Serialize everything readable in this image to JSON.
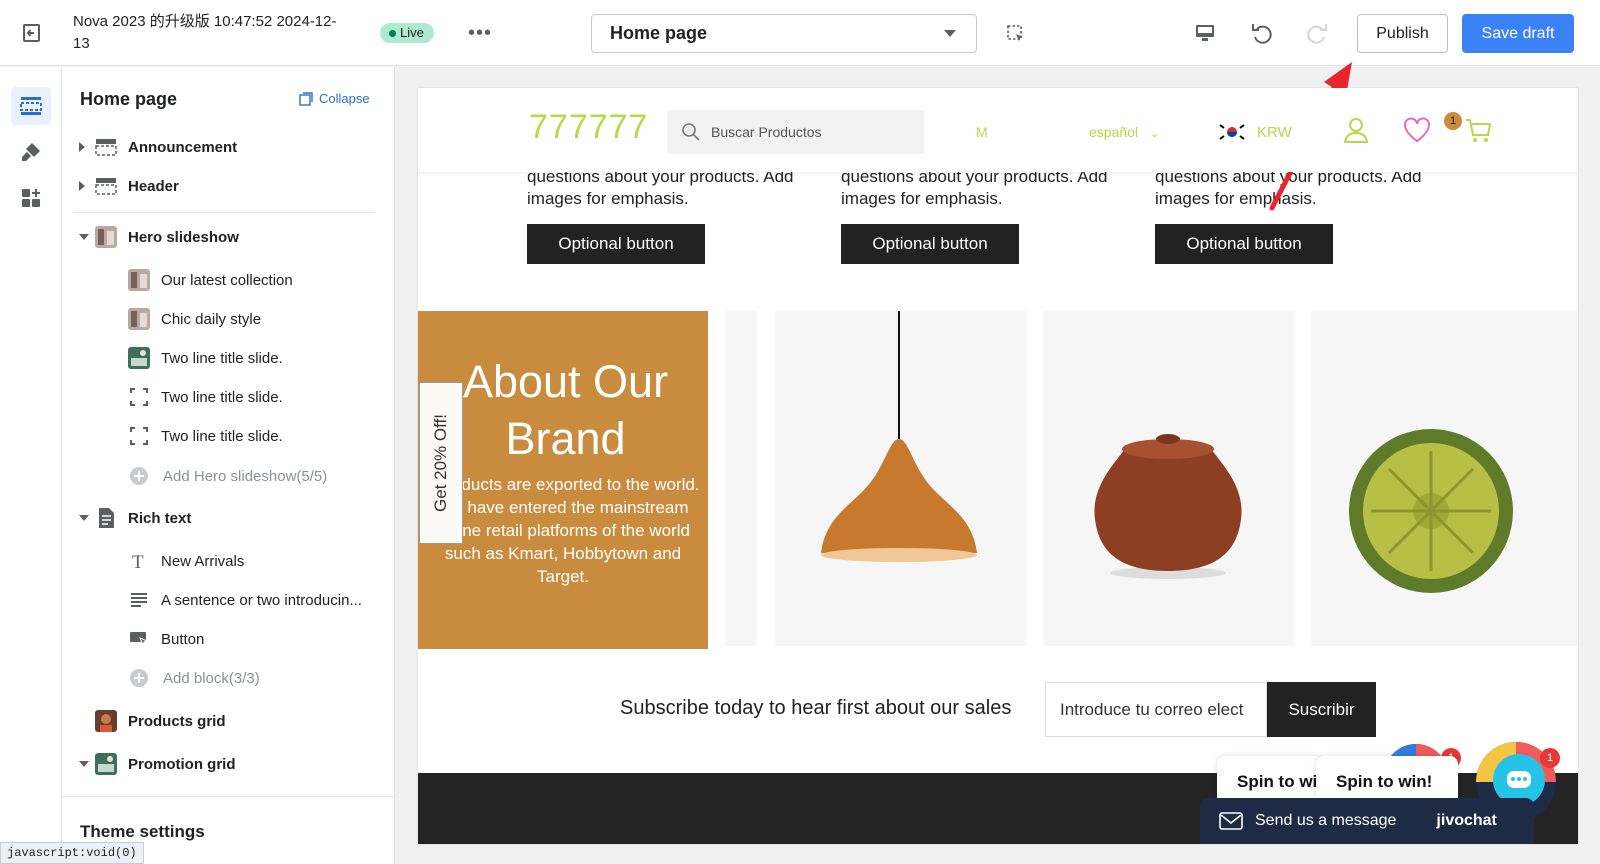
{
  "topbar": {
    "theme_name": "Nova 2023 的升级版 10:47:52 2024-12-13",
    "live_badge": "Live",
    "page_selector": "Home page",
    "publish_label": "Publish",
    "save_label": "Save draft"
  },
  "sidebar": {
    "title": "Home page",
    "collapse_label": "Collapse",
    "sections": [
      {
        "label": "Announcement"
      },
      {
        "label": "Header"
      },
      {
        "label": "Hero slideshow"
      },
      {
        "label": "Rich text"
      },
      {
        "label": "Products grid"
      },
      {
        "label": "Promotion grid"
      }
    ],
    "hero_blocks": [
      {
        "label": "Our latest collection"
      },
      {
        "label": "Chic daily style"
      },
      {
        "label": "Two line title slide."
      },
      {
        "label": "Two line title slide."
      },
      {
        "label": "Two line title slide."
      }
    ],
    "hero_add": "Add Hero slideshow(5/5)",
    "rich_blocks": [
      {
        "label": "New Arrivals"
      },
      {
        "label": "A sentence or two introducin..."
      },
      {
        "label": "Button"
      }
    ],
    "rich_add": "Add block(3/3)",
    "theme_settings": "Theme settings",
    "status_url": "javascript:void(0)"
  },
  "store": {
    "logo": "777777",
    "search_placeholder": "Buscar Productos",
    "nav_fragment": "M",
    "language": "español",
    "currency": "KRW",
    "wishlist_count": "1",
    "features": [
      {
        "text": "questions about your products. Add images for emphasis.",
        "button": "Optional button"
      },
      {
        "text": "questions about your products. Add images for emphasis.",
        "button": "Optional button"
      },
      {
        "text": "questions about your products. Add images for emphasis.",
        "button": "Optional button"
      }
    ],
    "about": {
      "title": "About Our Brand",
      "body": "r products are exported to the world. We have entered the mainstream offline retail platforms of the world such as Kmart, Hobbytown and Target."
    },
    "promo_tab": "Get 20% Off!",
    "subscribe_text": "Subscribe today to hear first about our sales",
    "email_value": "Introduce tu correo elect",
    "subscribe_button": "Suscribir"
  },
  "widgets": {
    "spin_label_1": "Spin to wi",
    "spin_label_2": "Spin to win!",
    "jivo_message": "Send us a message",
    "jivo_brand": "jivochat",
    "badge_1": "1",
    "badge_2": "1"
  },
  "colors": {
    "accent": "#3b82f6",
    "brand_green": "#b6d84b",
    "about_bg": "#c98b3d",
    "annotation_arrow": "#e8262d"
  }
}
